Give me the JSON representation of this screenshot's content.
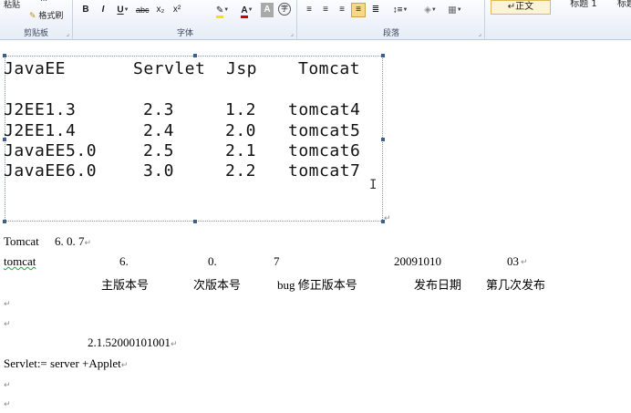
{
  "ribbon": {
    "clipboard": {
      "paste_label": "粘贴",
      "cut_label": "…",
      "format_painter_label": "格式刷",
      "group_label": "剪贴板"
    },
    "font": {
      "group_label": "字体",
      "bold": "B",
      "italic": "I",
      "underline": "U",
      "strike": "abc",
      "subscript": "x₂",
      "superscript": "x²",
      "highlight_color": "#f2e600",
      "font_color": "#d20000"
    },
    "paragraph": {
      "group_label": "段落"
    },
    "styles": {
      "items": [
        "↵正文",
        "标题 1",
        "标题"
      ]
    }
  },
  "image": {
    "header": [
      "JavaEE",
      "Servlet",
      "Jsp",
      "Tomcat"
    ],
    "rows": [
      [
        "J2EE1.3",
        "2.3",
        "1.2",
        "tomcat4"
      ],
      [
        "J2EE1.4",
        "2.4",
        "2.0",
        "tomcat5"
      ],
      [
        "JavaEE5.0",
        "2.5",
        "2.1",
        "tomcat6"
      ],
      [
        "JavaEE6.0",
        "3.0",
        "2.2",
        "tomcat7"
      ]
    ]
  },
  "doc": {
    "line1": "Tomcat",
    "line1_version": "6. 0. 7",
    "line2_label": "tomcat",
    "line2_parts": [
      "6.",
      "0.",
      "7",
      "20091010",
      "03"
    ],
    "line3_parts": [
      "主版本号",
      "次版本号",
      "bug 修正版本号",
      "发布日期",
      "第几次发布"
    ],
    "version_string": "2.1.52000101001",
    "servlet_line": "Servlet:= server +Applet",
    "para_mark": "↵"
  }
}
